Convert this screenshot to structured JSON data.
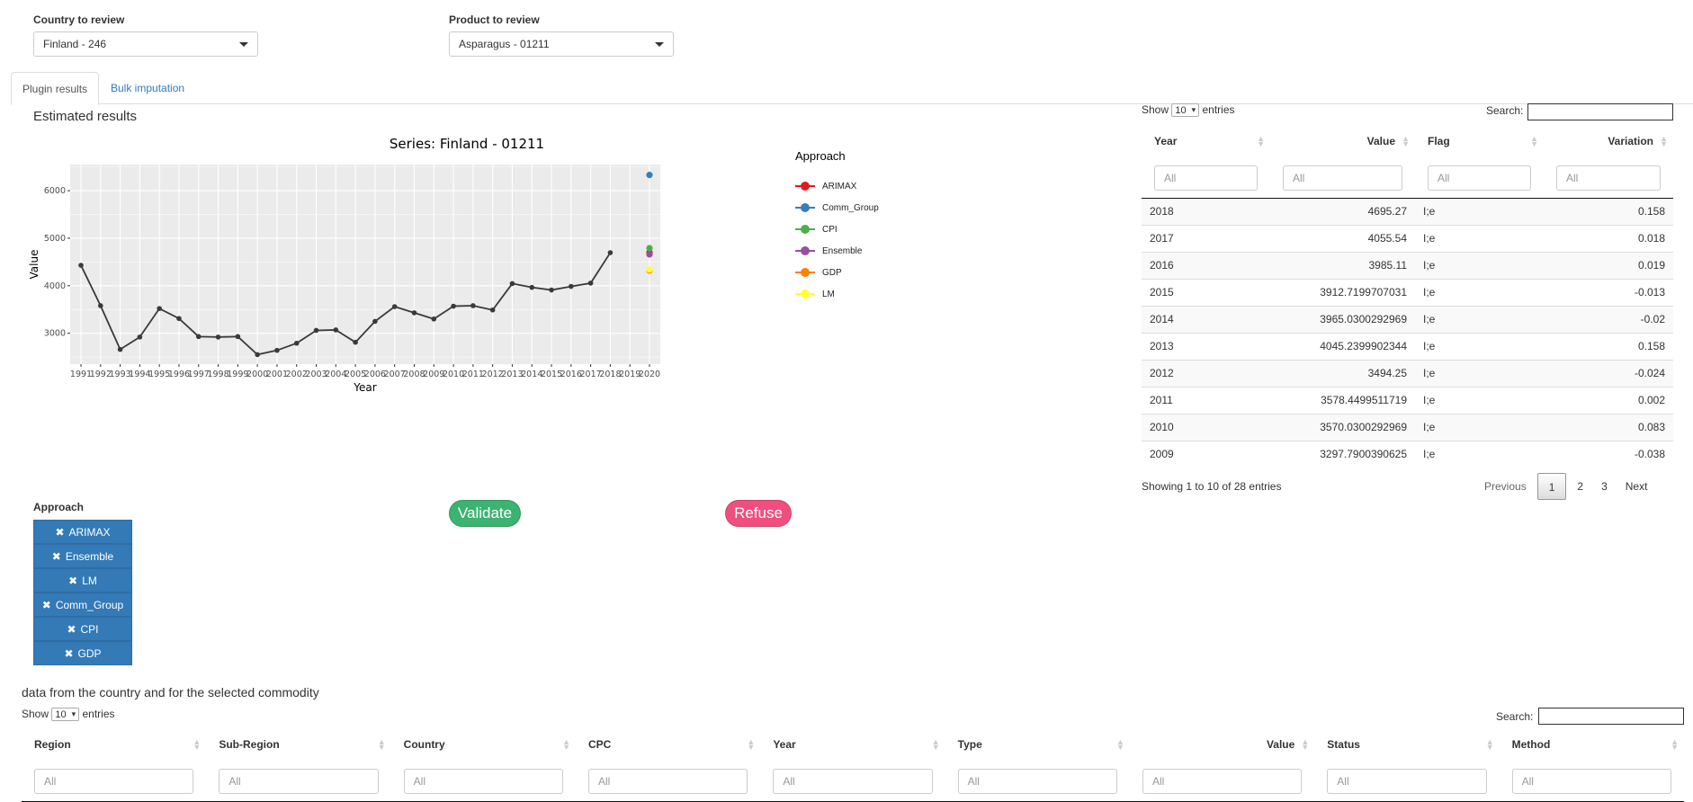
{
  "selectors": {
    "country_label": "Country to review",
    "country_value": "Finland - 246",
    "product_label": "Product to review",
    "product_value": "Asparagus - 01211"
  },
  "tabs": [
    {
      "label": "Plugin results"
    },
    {
      "label": "Bulk imputation"
    }
  ],
  "estimated_results_title": "Estimated results",
  "chart_data": {
    "type": "line",
    "title": "Series: Finland  -  01211",
    "xlabel": "Year",
    "ylabel": "Value",
    "ylim": [
      2350,
      6550
    ],
    "yticks": [
      3000,
      4000,
      5000,
      6000
    ],
    "x": [
      1991,
      1992,
      1993,
      1994,
      1995,
      1996,
      1997,
      1998,
      1999,
      2000,
      2001,
      2002,
      2003,
      2004,
      2005,
      2006,
      2007,
      2008,
      2009,
      2010,
      2011,
      2012,
      2013,
      2014,
      2015,
      2016,
      2017,
      2018,
      2019,
      2020
    ],
    "series": [
      {
        "values": [
          4430,
          3580,
          2660,
          2920,
          3520,
          3310,
          2930,
          2920,
          2930,
          2550,
          2640,
          2790,
          3060,
          3070,
          2810,
          3250,
          3560,
          3430,
          3300,
          3570,
          3580,
          3490,
          4045,
          3965,
          3910,
          3985,
          4055,
          4695,
          null,
          null
        ]
      }
    ],
    "grid": true,
    "legend_title": "Approach",
    "legend_position": "right",
    "approach_points": [
      {
        "name": "ARIMAX",
        "color": "#e41a1c",
        "x": 2020,
        "y": 4700
      },
      {
        "name": "Comm_Group",
        "color": "#377eb8",
        "x": 2020,
        "y": 6330
      },
      {
        "name": "CPI",
        "color": "#4daf4a",
        "x": 2020,
        "y": 4790
      },
      {
        "name": "Ensemble",
        "color": "#984ea3",
        "x": 2020,
        "y": 4660
      },
      {
        "name": "GDP",
        "color": "#ff7f00",
        "x": 2020,
        "y": 4320
      },
      {
        "name": "LM",
        "color": "#ffff33",
        "x": 2020,
        "y": 4340
      }
    ]
  },
  "approach_panel": {
    "label": "Approach",
    "buttons": [
      "ARIMAX",
      "Ensemble",
      "LM",
      "Comm_Group",
      "CPI",
      "GDP"
    ],
    "remove_glyph": "✖"
  },
  "actions": {
    "validate": "Validate",
    "refuse": "Refuse",
    "validate_color": "#3cb371",
    "refuse_color": "#ef4f7f"
  },
  "results_table": {
    "show_label": "Show",
    "entries_label": "entries",
    "length_value": "10",
    "search_label": "Search:",
    "columns": [
      "Year",
      "Value",
      "Flag",
      "Variation"
    ],
    "filter_placeholder": "All",
    "rows": [
      [
        "2018",
        "4695.27",
        "I;e",
        "0.158"
      ],
      [
        "2017",
        "4055.54",
        "I;e",
        "0.018"
      ],
      [
        "2016",
        "3985.11",
        "I;e",
        "0.019"
      ],
      [
        "2015",
        "3912.7199707031",
        "I;e",
        "-0.013"
      ],
      [
        "2014",
        "3965.0300292969",
        "I;e",
        "-0.02"
      ],
      [
        "2013",
        "4045.2399902344",
        "I;e",
        "0.158"
      ],
      [
        "2012",
        "3494.25",
        "I;e",
        "-0.024"
      ],
      [
        "2011",
        "3578.4499511719",
        "I;e",
        "0.002"
      ],
      [
        "2010",
        "3570.0300292969",
        "I;e",
        "0.083"
      ],
      [
        "2009",
        "3297.7900390625",
        "I;e",
        "-0.038"
      ]
    ],
    "info": "Showing 1 to 10 of 28 entries",
    "pager": {
      "previous": "Previous",
      "pages": [
        "1",
        "2",
        "3"
      ],
      "next": "Next",
      "current": "1"
    }
  },
  "country_data": {
    "title": "data from the country and for the selected commodity",
    "show_label": "Show",
    "entries_label": "entries",
    "length_value": "10",
    "search_label": "Search:",
    "columns": [
      "Region",
      "Sub-Region",
      "Country",
      "CPC",
      "Year",
      "Type",
      "Value",
      "Status",
      "Method"
    ],
    "filter_placeholder": "All"
  }
}
